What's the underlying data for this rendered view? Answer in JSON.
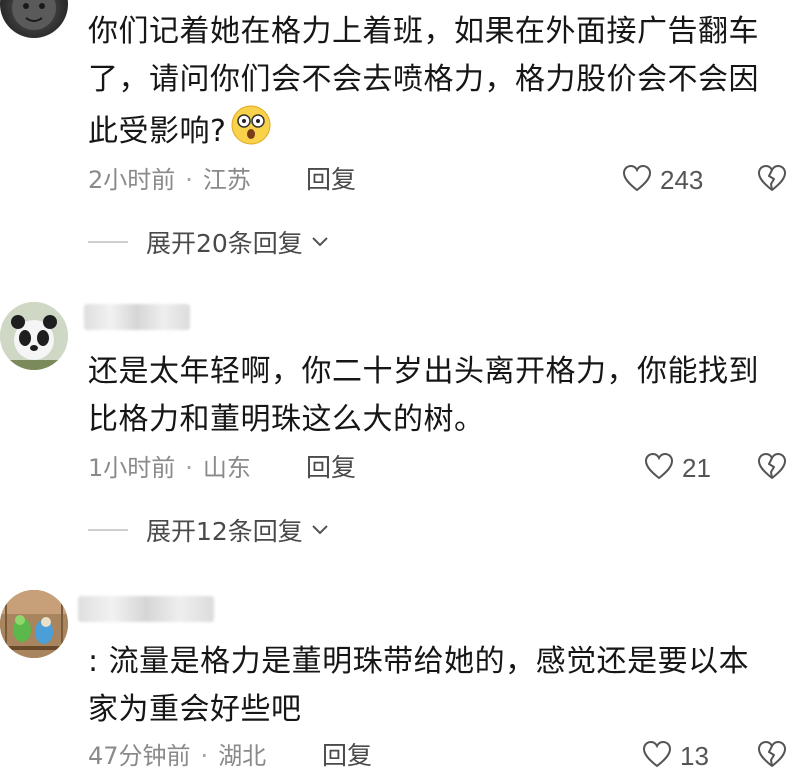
{
  "comments": [
    {
      "text_lines": [
        "你们记着她在格力上着班，如果在外面接广告翻车",
        "了，请问你们会不会去喷格力，格力股价会不会因",
        "此受影响?"
      ],
      "time": "2小时前",
      "location": "江苏",
      "reply_label": "回复",
      "likes": "243",
      "expand_label": "展开20条回复"
    },
    {
      "text_lines": [
        "还是太年轻啊，你二十岁出头离开格力，你能找到",
        "比格力和董明珠这么大的树。"
      ],
      "time": "1小时前",
      "location": "山东",
      "reply_label": "回复",
      "likes": "21",
      "expand_label": "展开12条回复"
    },
    {
      "text_lines": [
        ": 流量是格力是董明珠带给她的，感觉还是要以本",
        "家为重会好些吧"
      ],
      "time": "47分钟前",
      "location": "湖北",
      "reply_label": "回复",
      "likes": "13"
    }
  ],
  "icons": {
    "like": "heart-outline-icon",
    "dislike": "broken-heart-icon",
    "expand": "chevron-down-icon",
    "emoji": "surprised-emoji-icon"
  },
  "colors": {
    "text": "#161616",
    "meta": "#8a8a8a",
    "divider": "#cfcfcf"
  }
}
